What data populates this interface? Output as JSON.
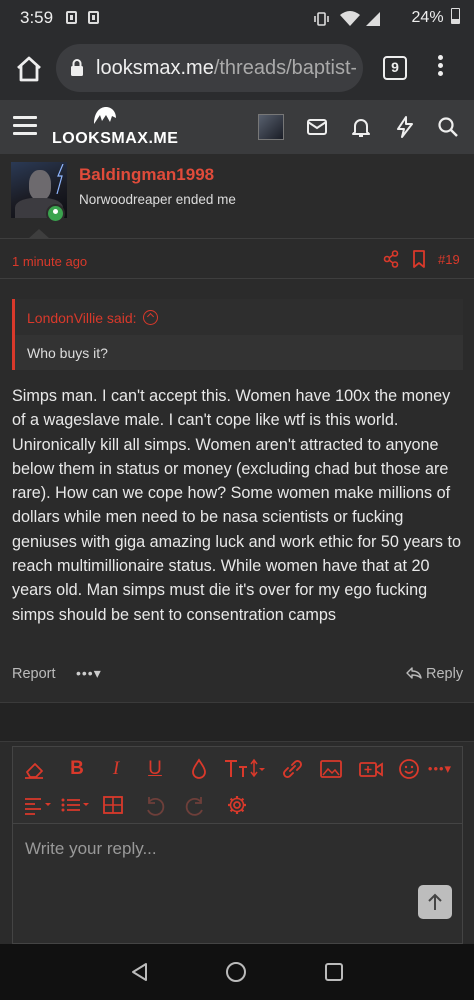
{
  "status": {
    "time": "3:59",
    "battery": "24%"
  },
  "browser": {
    "url_domain": "looksmax.me",
    "url_path": "/threads/baptist-",
    "tab_count": "9"
  },
  "site": {
    "logo_text": "LOOKSMAX.ME"
  },
  "post": {
    "username": "Baldingman1998",
    "user_title": "Norwoodreaper ended me",
    "timestamp": "1 minute ago",
    "post_number": "#19",
    "quote_author": "LondonVillie said:",
    "quote_text": "Who buys it?",
    "body": "Simps man. I can't accept this. Women have 100x the money of a wageslave male. I can't cope like wtf is this world. Unironically kill all simps. Women aren't attracted to anyone below them in status or money (excluding chad but those are rare). How can we cope how? Some women make millions of dollars while men need to be nasa scientists or fucking geniuses with giga amazing luck and work ethic for 50 years to reach multimillionaire status. While women have that at 20 years old. Man simps must die it's over for my ego fucking simps should be sent to consentration camps",
    "report_label": "Report",
    "more_label": "•••▾",
    "reply_label": "Reply"
  },
  "editor": {
    "placeholder": "Write your reply...",
    "bold": "B",
    "italic": "I",
    "underline": "U"
  },
  "colors": {
    "accent": "#d9392b",
    "background": "#2b2b2b"
  }
}
